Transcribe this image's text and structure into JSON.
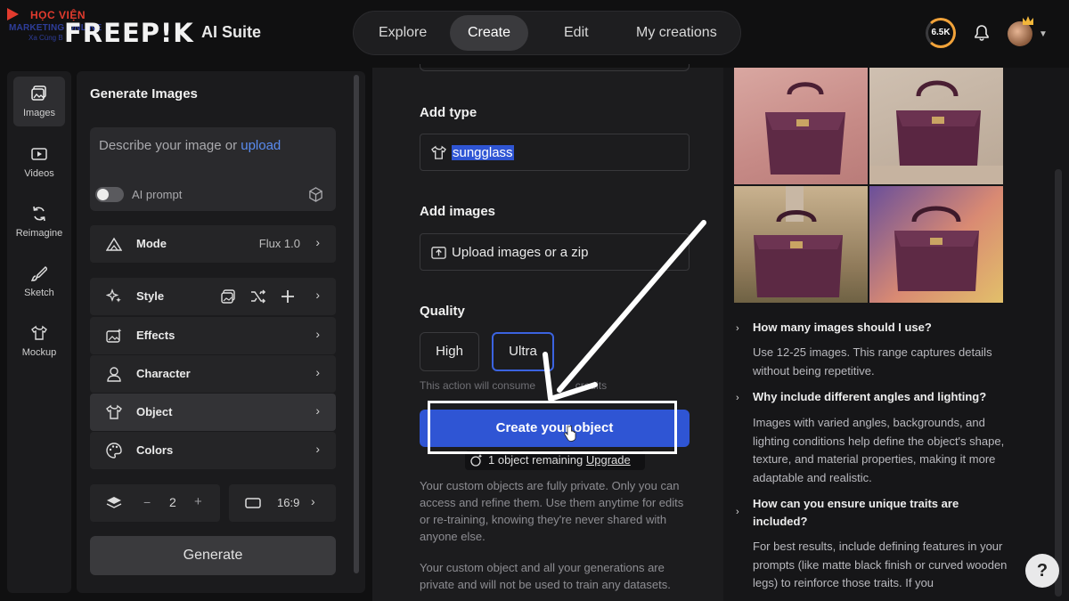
{
  "header": {
    "brand": "FREEP!K",
    "suite": "AI Suite",
    "nav_tabs": [
      {
        "label": "Explore"
      },
      {
        "label": "Create"
      },
      {
        "label": "Edit"
      },
      {
        "label": "My creations"
      }
    ],
    "active_tab": "Create",
    "credits": "6.5K",
    "watermark": {
      "line1": "HỌC VIỆN",
      "line2": "MARKETING ONLINE",
      "line3": "Xa Cùng B"
    }
  },
  "rail": {
    "items": [
      {
        "label": "Images",
        "icon": "images-icon"
      },
      {
        "label": "Videos",
        "icon": "videos-icon"
      },
      {
        "label": "Reimagine",
        "icon": "reimagine-icon"
      },
      {
        "label": "Sketch",
        "icon": "sketch-icon"
      },
      {
        "label": "Mockup",
        "icon": "mockup-icon"
      }
    ],
    "active": "Images"
  },
  "panel": {
    "title": "Generate Images",
    "prompt_placeholder": "Describe your image or",
    "prompt_link": "upload",
    "ai_prompt_label": "AI prompt",
    "ai_prompt_on": false,
    "mode": {
      "label": "Mode",
      "value": "Flux 1.0"
    },
    "options": [
      {
        "label": "Style"
      },
      {
        "label": "Effects"
      },
      {
        "label": "Character"
      },
      {
        "label": "Object"
      },
      {
        "label": "Colors"
      }
    ],
    "selected_option": "Object",
    "count": {
      "minus": "−",
      "value": "2",
      "plus": "+"
    },
    "aspect": "16:9",
    "generate_label": "Generate"
  },
  "middle": {
    "add_type_label": "Add type",
    "type_value": "sungglass",
    "add_images_label": "Add images",
    "upload_label": "Upload images or a zip",
    "quality_label": "Quality",
    "quality_options": [
      "High",
      "Ultra"
    ],
    "quality_selected": "Ultra",
    "consume_text": "This action will consume",
    "consume_tail": "credits",
    "create_label": "Create your object",
    "remaining_text": "1 object remaining",
    "upgrade_label": "Upgrade",
    "para1": "Your custom objects are fully private. Only you can access and refine them. Use them anytime for edits or re-training, knowing they're never shared with anyone else.",
    "para2": "Your custom object and all your generations are private and will not be used to train any datasets."
  },
  "right": {
    "faq": [
      {
        "q": "How many images should I use?",
        "a": "Use 12-25 images. This range captures details without being repetitive."
      },
      {
        "q": "Why include different angles and lighting?",
        "a": "Images with varied angles, backgrounds, and lighting conditions help define the object's shape, texture, and material properties, making it more adaptable and realistic."
      },
      {
        "q": "How can you ensure unique traits are included?",
        "a": "For best results, include defining features in your prompts (like matte black finish or curved wooden legs) to reinforce those traits. If you"
      }
    ],
    "help": "?"
  },
  "colors": {
    "accent": "#2f55d4",
    "bag": "#5e2a45",
    "credits_ring": "#f2a33a"
  }
}
